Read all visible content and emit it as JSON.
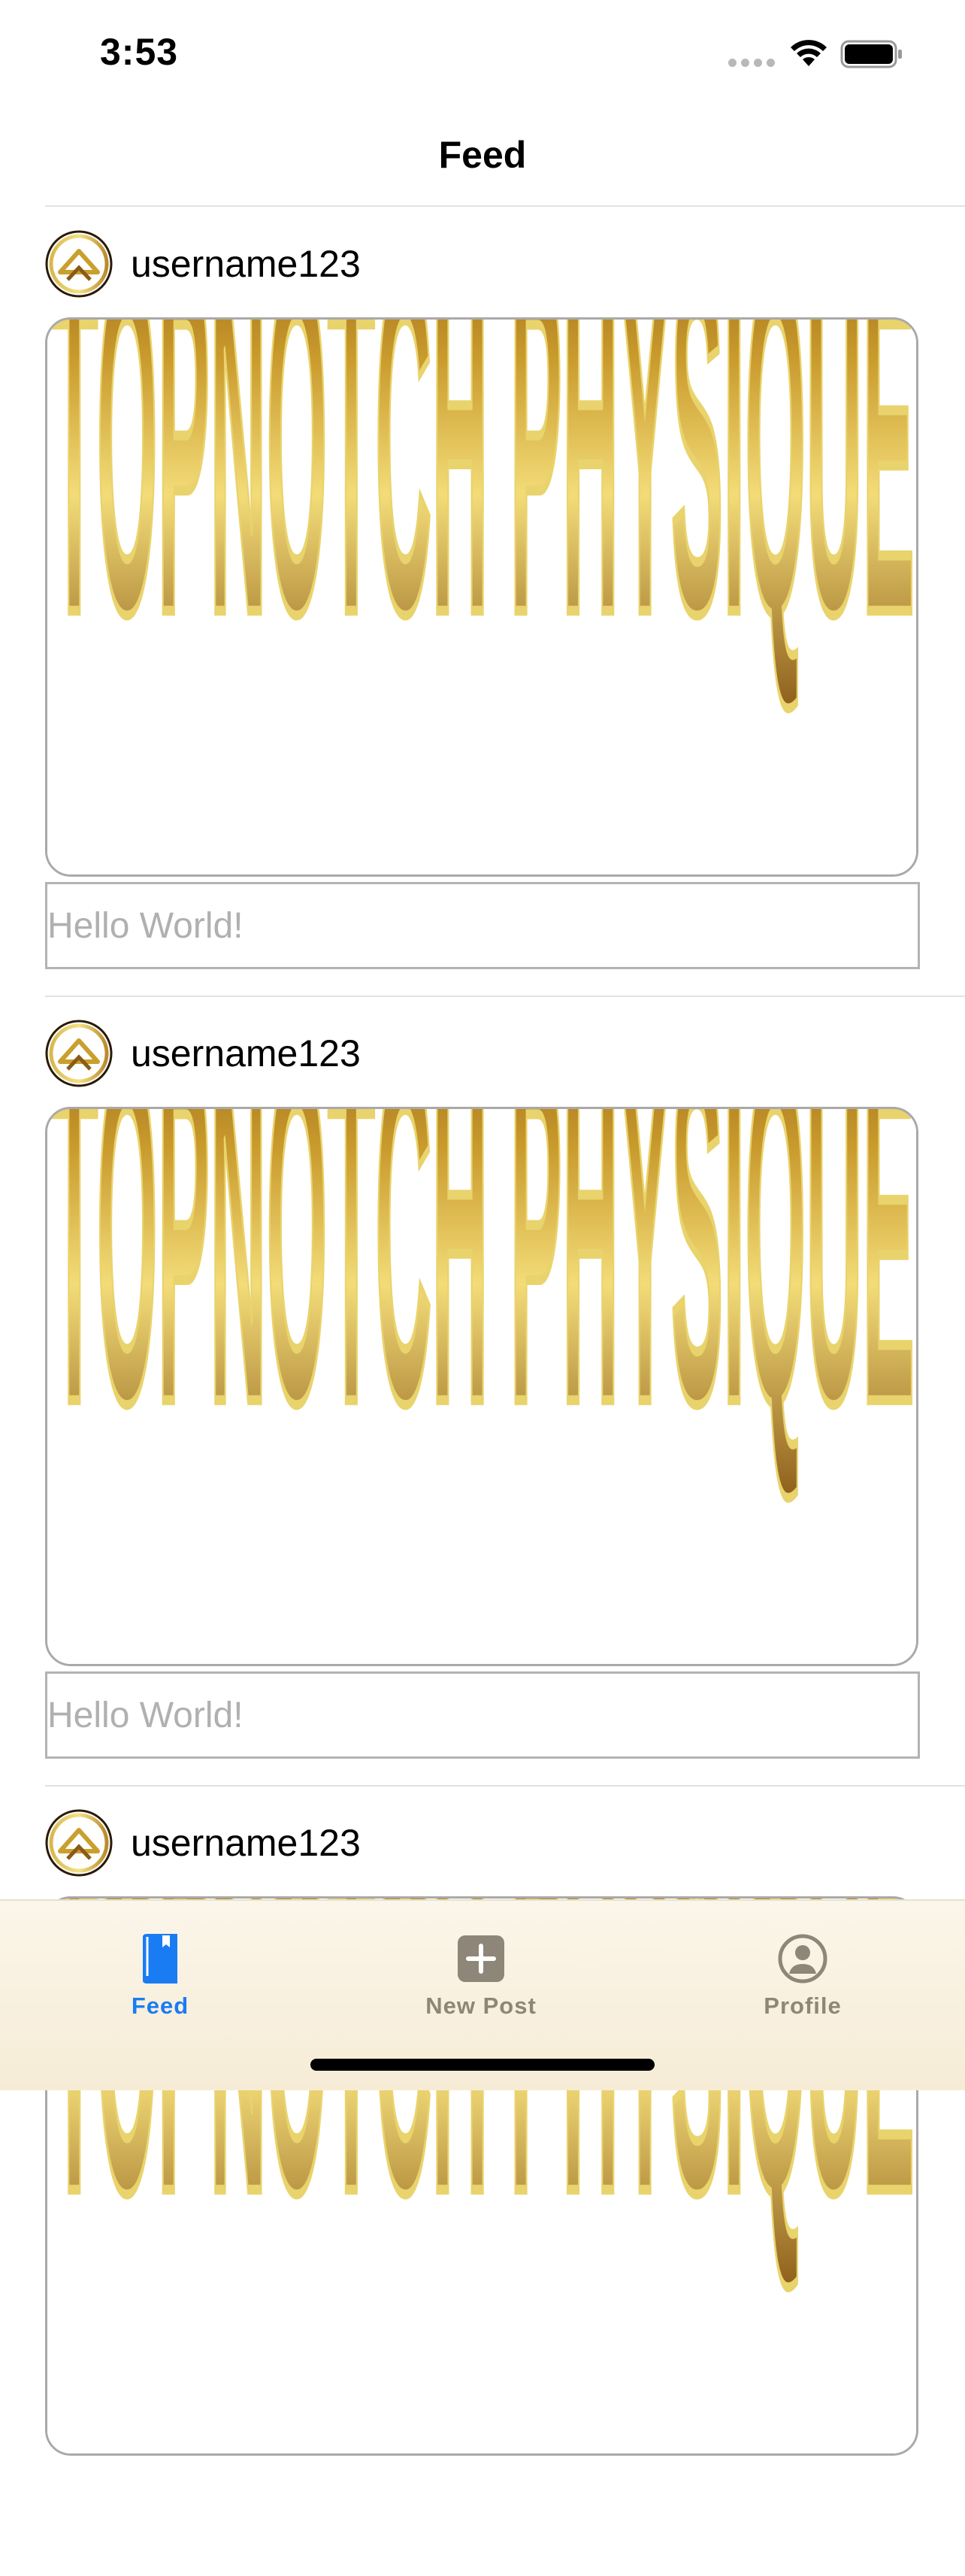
{
  "status_bar": {
    "time": "3:53"
  },
  "nav": {
    "title": "Feed"
  },
  "posts": [
    {
      "username": "username123",
      "image_text": "TOPNOTCH PHYSIQUE",
      "caption_placeholder": "Hello World!"
    },
    {
      "username": "username123",
      "image_text": "TOPNOTCH PHYSIQUE",
      "caption_placeholder": "Hello World!"
    },
    {
      "username": "username123",
      "image_text": "TOPNOTCH PHYSIQUE",
      "caption_placeholder": ""
    }
  ],
  "tab_bar": {
    "tabs": [
      {
        "label": "Feed",
        "icon": "book-icon",
        "selected": true
      },
      {
        "label": "New Post",
        "icon": "plus-square-icon",
        "selected": false
      },
      {
        "label": "Profile",
        "icon": "person-circle-icon",
        "selected": false
      }
    ]
  },
  "colors": {
    "accent": "#1a7cf3",
    "tab_inactive": "#8e8678",
    "gold_dark": "#7a4a12",
    "gold_mid": "#c9a02e",
    "gold_light": "#f3dc78"
  }
}
